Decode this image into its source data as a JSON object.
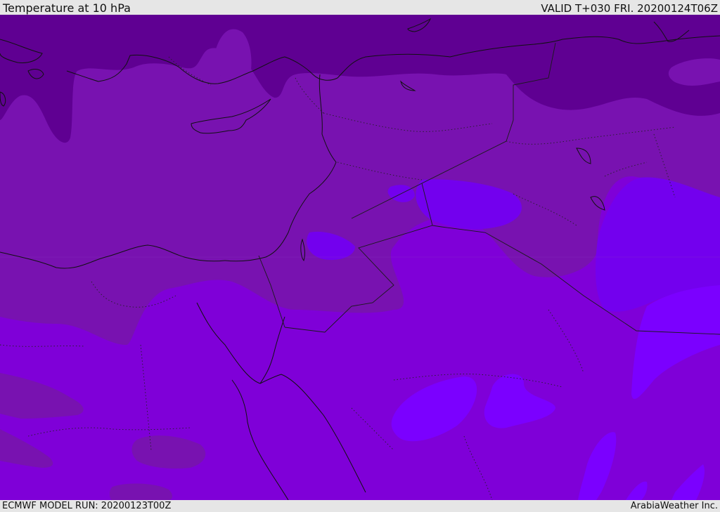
{
  "header": {
    "title": "Temperature at 10 hPa",
    "valid": "VALID T+030 FRI. 20200124T06Z"
  },
  "footer": {
    "model_run": "ECMWF MODEL RUN: 20200123T00Z",
    "credit": "ArabiaWeather Inc."
  },
  "map": {
    "field": "temperature",
    "level": "10 hPa",
    "colors": {
      "band_darkest": "#5f0090",
      "band_dark": "#7a12b2",
      "band_mid": "#7f00d8",
      "band_light": "#7000f0",
      "band_lightest": "#7b00ff",
      "coastline": "#111111",
      "border": "#1a1a1a"
    }
  }
}
